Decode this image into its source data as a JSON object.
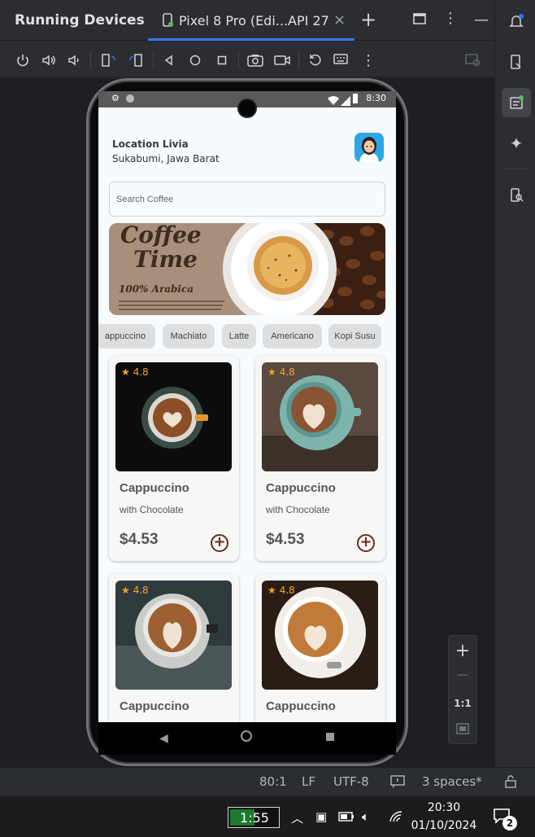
{
  "ide": {
    "panel_title": "Running Devices",
    "device_tab": "Pixel 8 Pro (Edi...API 27",
    "tab_close": "×",
    "add_tab": "+"
  },
  "zoom": {
    "plus": "+",
    "minus": "—",
    "one_to_one": "1:1"
  },
  "statusbar": {
    "position": "80:1",
    "line_ending": "LF",
    "encoding": "UTF-8",
    "indent": "3 spaces*"
  },
  "taskbar": {
    "battery_time": "1:55",
    "clock_time": "20:30",
    "clock_date": "01/10/2024",
    "notifications": "2"
  },
  "android": {
    "status_time": "8:30"
  },
  "app": {
    "location_title": "Location Livia",
    "location_sub": "Sukabumi, Jawa Barat",
    "search_placeholder": "Search Coffee",
    "banner": {
      "title_line1": "Coffee",
      "title_line2": "Time",
      "subtitle": "100% Arabica"
    },
    "chips": [
      "appuccino",
      "Machiato",
      "Latte",
      "Americano",
      "Kopi Susu"
    ],
    "products": [
      {
        "rating": "4.8",
        "name": "Cappuccino",
        "sub": "with Chocolate",
        "price": "$4.53"
      },
      {
        "rating": "4.8",
        "name": "Cappuccino",
        "sub": "with Chocolate",
        "price": "$4.53"
      },
      {
        "rating": "4.8",
        "name": "Cappuccino",
        "sub": "",
        "price": ""
      },
      {
        "rating": "4.8",
        "name": "Cappuccino",
        "sub": "",
        "price": ""
      }
    ]
  },
  "colors": {
    "accent": "#3574f0",
    "brand_brown": "#6b2a1f",
    "rating": "#f0a32a"
  }
}
